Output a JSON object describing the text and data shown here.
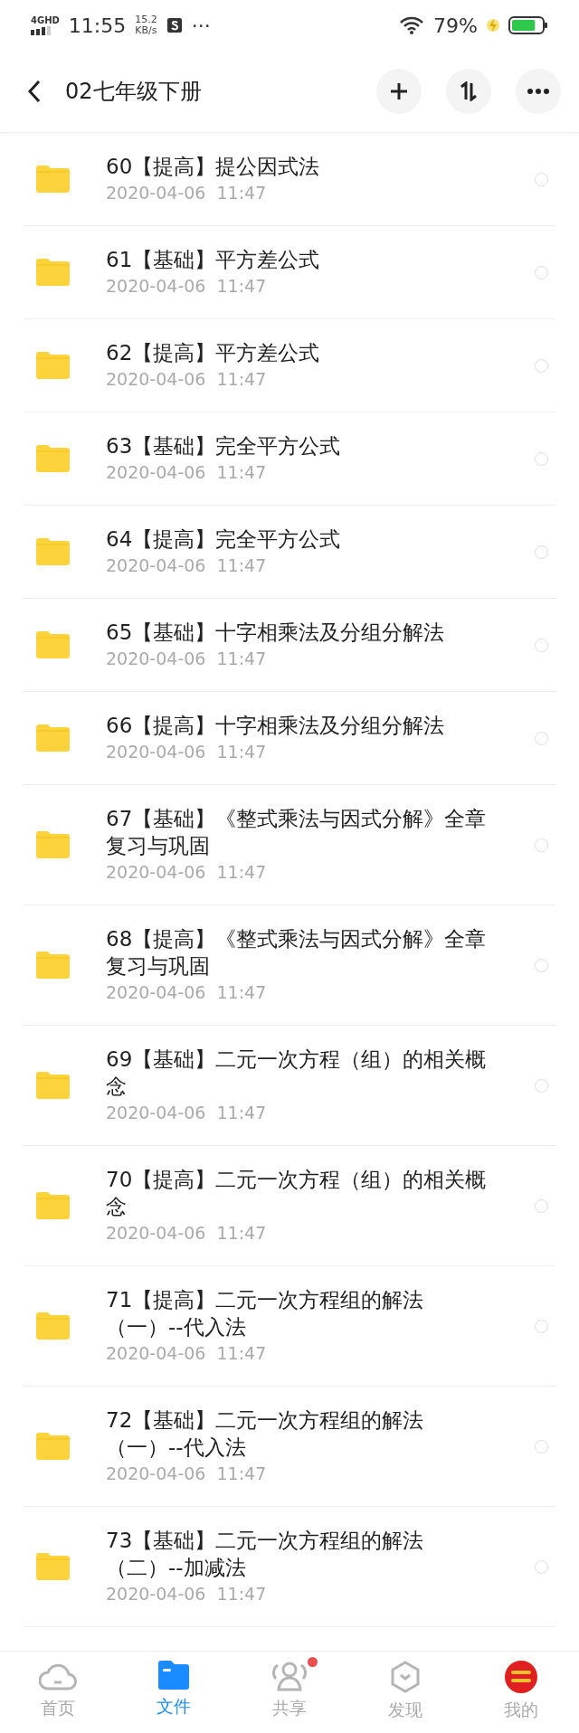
{
  "status_bar": {
    "network": "4GHD",
    "time": "11:55",
    "speed_value": "15.2",
    "speed_unit": "KB/s",
    "more": "···",
    "battery": "79%"
  },
  "header": {
    "title": "02七年级下册"
  },
  "files": [
    {
      "name": "60【提高】提公因式法",
      "date": "2020-04-06  11:47",
      "selected": false
    },
    {
      "name": "61【基础】平方差公式",
      "date": "2020-04-06  11:47",
      "selected": false
    },
    {
      "name": "62【提高】平方差公式",
      "date": "2020-04-06  11:47",
      "selected": false
    },
    {
      "name": "63【基础】完全平方公式",
      "date": "2020-04-06  11:47",
      "selected": false
    },
    {
      "name": "64【提高】完全平方公式",
      "date": "2020-04-06  11:47",
      "selected": false
    },
    {
      "name": "65【基础】十字相乘法及分组分解法",
      "date": "2020-04-06  11:47",
      "selected": false
    },
    {
      "name": "66【提高】十字相乘法及分组分解法",
      "date": "2020-04-06  11:47",
      "selected": false
    },
    {
      "name": "67【基础】《整式乘法与因式分解》全章复习与巩固",
      "date": "2020-04-06  11:47",
      "selected": false
    },
    {
      "name": "68【提高】《整式乘法与因式分解》全章复习与巩固",
      "date": "2020-04-06  11:47",
      "selected": false
    },
    {
      "name": "69【基础】二元一次方程（组）的相关概念",
      "date": "2020-04-06  11:47",
      "selected": false
    },
    {
      "name": "70【提高】二元一次方程（组）的相关概念",
      "date": "2020-04-06  11:47",
      "selected": false
    },
    {
      "name": "71【提高】二元一次方程组的解法（一）--代入法",
      "date": "2020-04-06  11:47",
      "selected": false
    },
    {
      "name": "72【基础】二元一次方程组的解法（一）--代入法",
      "date": "2020-04-06  11:47",
      "selected": false
    },
    {
      "name": "73【基础】二元一次方程组的解法（二）--加减法",
      "date": "2020-04-06  11:47",
      "selected": false
    }
  ],
  "nav": [
    {
      "kind": "cloud",
      "label": "首页",
      "selected": false,
      "badge": false
    },
    {
      "kind": "folder",
      "label": "文件",
      "selected": true,
      "badge": false
    },
    {
      "kind": "people",
      "label": "共享",
      "selected": false,
      "badge": true
    },
    {
      "kind": "cube",
      "label": "发现",
      "selected": false,
      "badge": false
    },
    {
      "kind": "avatar",
      "label": "我的",
      "selected": false,
      "badge": false
    }
  ]
}
